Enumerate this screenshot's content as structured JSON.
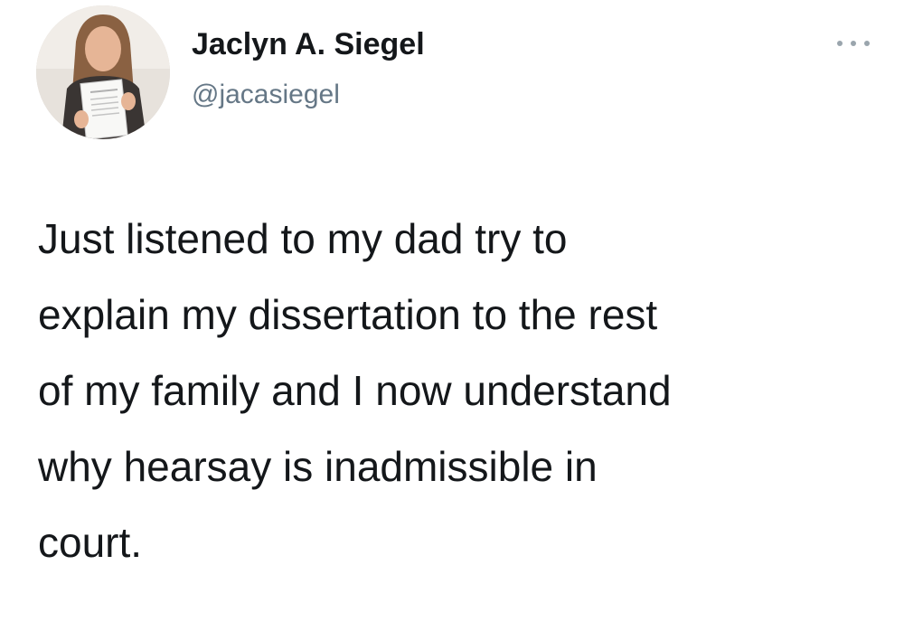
{
  "tweet": {
    "author": {
      "display_name": "Jaclyn A. Siegel",
      "handle": "@jacasiegel",
      "avatar": "profile-photo"
    },
    "more_icon": "more-options-icon",
    "text": "Just listened to my dad try to\nexplain my dissertation to the rest\nof my family and I now understand\nwhy hearsay is inadmissible in\ncourt."
  }
}
